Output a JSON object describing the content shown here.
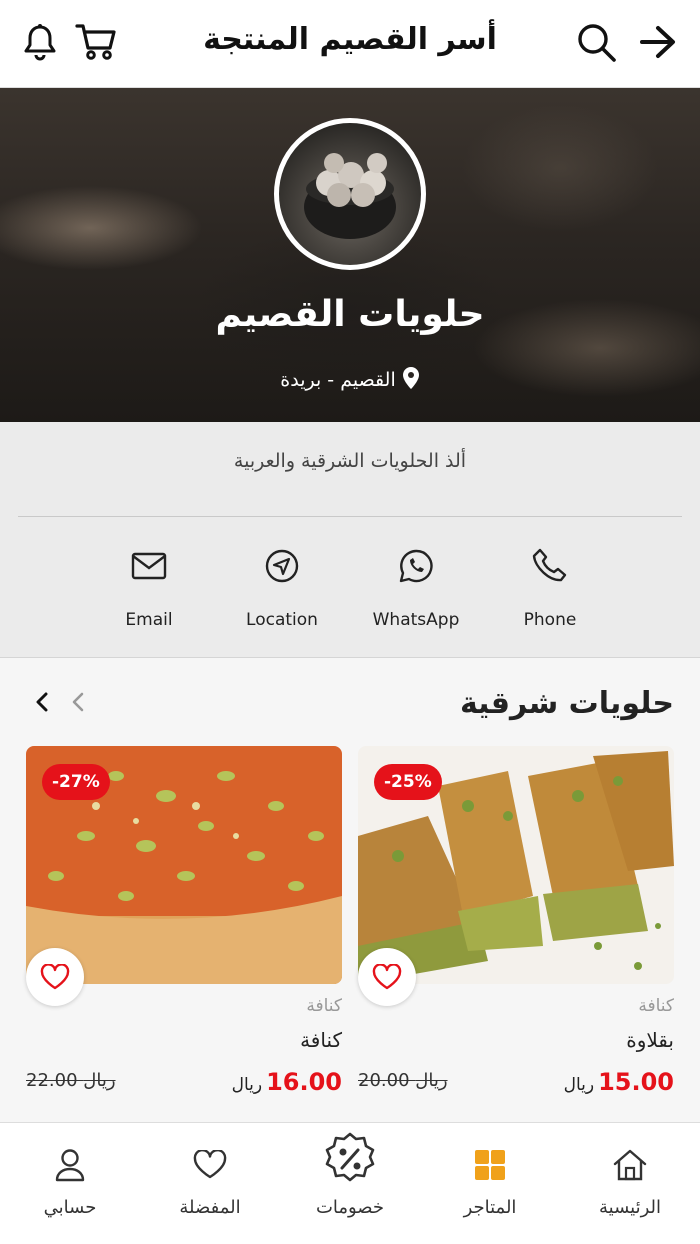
{
  "header": {
    "title": "أسر القصيم المنتجة"
  },
  "store": {
    "name": "حلويات القصيم",
    "location": "القصيم - بريدة",
    "description": "ألذ الحلويات الشرقية والعربية"
  },
  "contacts": [
    {
      "label": "Phone",
      "icon": "phone-icon"
    },
    {
      "label": "WhatsApp",
      "icon": "whatsapp-icon"
    },
    {
      "label": "Location",
      "icon": "location-icon"
    },
    {
      "label": "Email",
      "icon": "email-icon"
    }
  ],
  "section": {
    "title": "حلويات شرقية"
  },
  "products": [
    {
      "discount": "-25%",
      "category": "كنافة",
      "name": "بقلاوة",
      "price": "15.00",
      "currency": "ريال",
      "old_price": "20.00 ريال"
    },
    {
      "discount": "-27%",
      "category": "كنافة",
      "name": "كنافة",
      "price": "16.00",
      "currency": "ريال",
      "old_price": "22.00 ريال"
    }
  ],
  "nav": [
    {
      "label": "الرئيسية",
      "icon": "home-icon"
    },
    {
      "label": "المتاجر",
      "icon": "stores-icon"
    },
    {
      "label": "خصومات",
      "icon": "discount-icon"
    },
    {
      "label": "المفضلة",
      "icon": "heart-icon"
    },
    {
      "label": "حسابي",
      "icon": "user-icon"
    }
  ],
  "colors": {
    "accent": "#e5121a",
    "active_nav": "#f0a11a"
  }
}
